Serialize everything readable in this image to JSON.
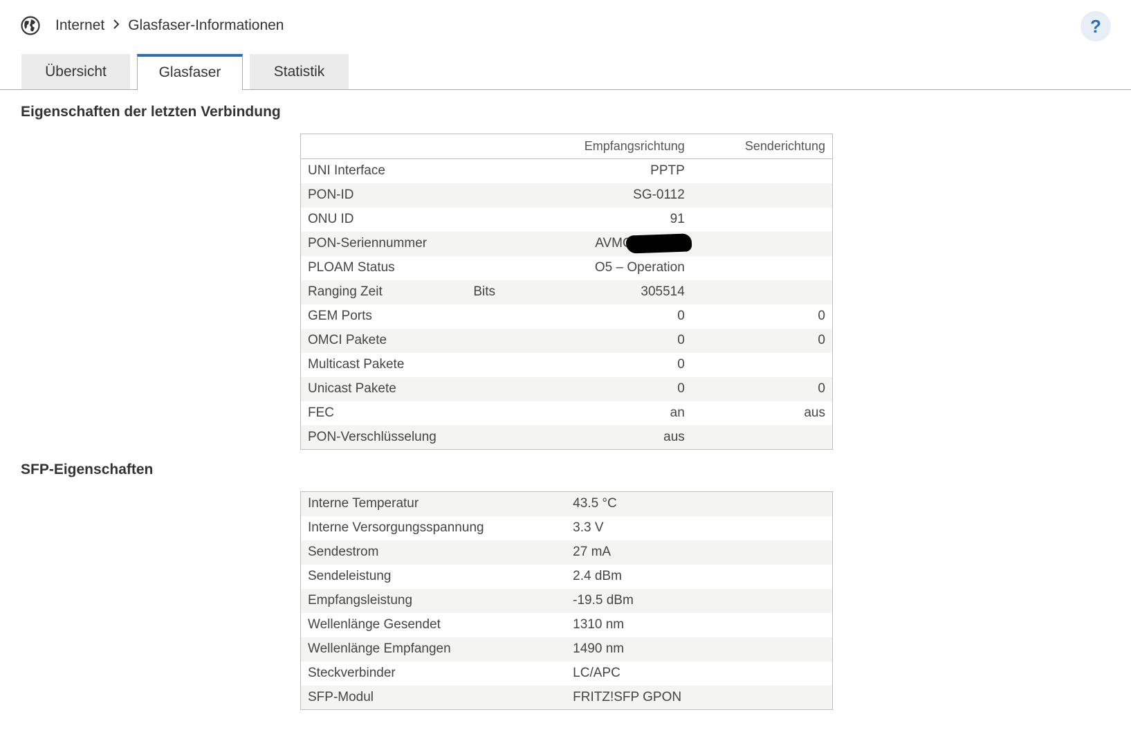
{
  "breadcrumb": {
    "root": "Internet",
    "current": "Glasfaser-Informationen"
  },
  "help": {
    "label": "?"
  },
  "tabs": [
    {
      "label": "Übersicht",
      "active": false
    },
    {
      "label": "Glasfaser",
      "active": true
    },
    {
      "label": "Statistik",
      "active": false
    }
  ],
  "connection": {
    "title": "Eigenschaften der letzten Verbindung",
    "headers": {
      "rx": "Empfangsrichtung",
      "tx": "Senderichtung"
    },
    "rows": [
      {
        "label": "UNI Interface",
        "unit": "",
        "rx": "PPTP",
        "tx": ""
      },
      {
        "label": "PON-ID",
        "unit": "",
        "rx": "SG-0112",
        "tx": ""
      },
      {
        "label": "ONU ID",
        "unit": "",
        "rx": "91",
        "tx": ""
      },
      {
        "label": "PON-Seriennummer",
        "unit": "",
        "rx": "AVMG",
        "tx": ""
      },
      {
        "label": "PLOAM Status",
        "unit": "",
        "rx": "O5 – Operation",
        "tx": ""
      },
      {
        "label": "Ranging Zeit",
        "unit": "Bits",
        "rx": "305514",
        "tx": ""
      },
      {
        "label": "GEM Ports",
        "unit": "",
        "rx": "0",
        "tx": "0"
      },
      {
        "label": "OMCI Pakete",
        "unit": "",
        "rx": "0",
        "tx": "0"
      },
      {
        "label": "Multicast Pakete",
        "unit": "",
        "rx": "0",
        "tx": ""
      },
      {
        "label": "Unicast Pakete",
        "unit": "",
        "rx": "0",
        "tx": "0"
      },
      {
        "label": "FEC",
        "unit": "",
        "rx": "an",
        "tx": "aus"
      },
      {
        "label": "PON-Verschlüsselung",
        "unit": "",
        "rx": "aus",
        "tx": ""
      }
    ]
  },
  "sfp": {
    "title": "SFP-Eigenschaften",
    "rows": [
      {
        "label": "Interne Temperatur",
        "value": "43.5 °C"
      },
      {
        "label": "Interne Versorgungsspannung",
        "value": "3.3 V"
      },
      {
        "label": "Sendestrom",
        "value": "27 mA"
      },
      {
        "label": "Sendeleistung",
        "value": "2.4 dBm"
      },
      {
        "label": "Empfangsleistung",
        "value": "-19.5 dBm"
      },
      {
        "label": "Wellenlänge Gesendet",
        "value": "1310 nm"
      },
      {
        "label": "Wellenlänge Empfangen",
        "value": "1490 nm"
      },
      {
        "label": "Steckverbinder",
        "value": "LC/APC"
      },
      {
        "label": "SFP-Modul",
        "value": "FRITZ!SFP GPON"
      }
    ]
  }
}
